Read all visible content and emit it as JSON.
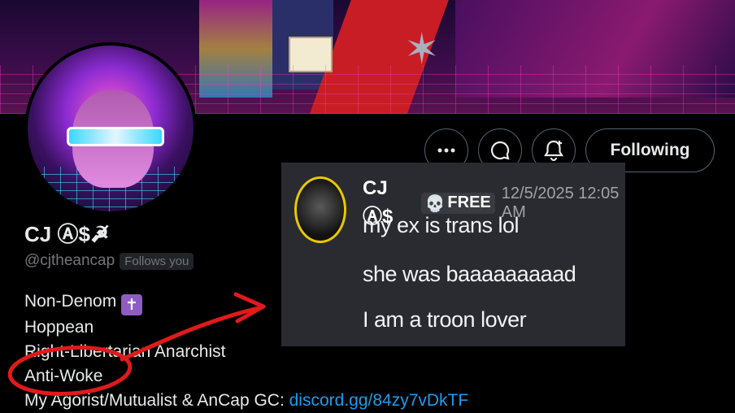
{
  "profile": {
    "name": "CJ Ⓐ$☭̸",
    "handle": "@cjtheancap",
    "follows_badge": "Follows you",
    "bio": {
      "line1": "Non-Denom",
      "line1_emoji": "✝",
      "line2": "Hoppean",
      "line3": "Right-Libertarian Anarchist",
      "line4": "Anti-Woke",
      "line5_prefix": "My Agorist/Mutualist & AnCap GC: ",
      "line5_link": "discord.gg/84zy7vDkTF"
    }
  },
  "actions": {
    "more_icon": "more-icon",
    "message_icon": "message-icon",
    "notify_icon": "notify-bell-icon",
    "following_label": "Following"
  },
  "overlay": {
    "username": "CJ Ⓐ$",
    "badge_label": "FREE",
    "badge_icon": "skull-icon",
    "timestamp": "12/5/2025 12:05 AM",
    "messages": [
      "my ex is trans lol",
      "she was baaaaaaaaad",
      "I am a troon lover"
    ]
  },
  "colors": {
    "annotation": "#e01a1a",
    "link": "#1d9bf0"
  }
}
